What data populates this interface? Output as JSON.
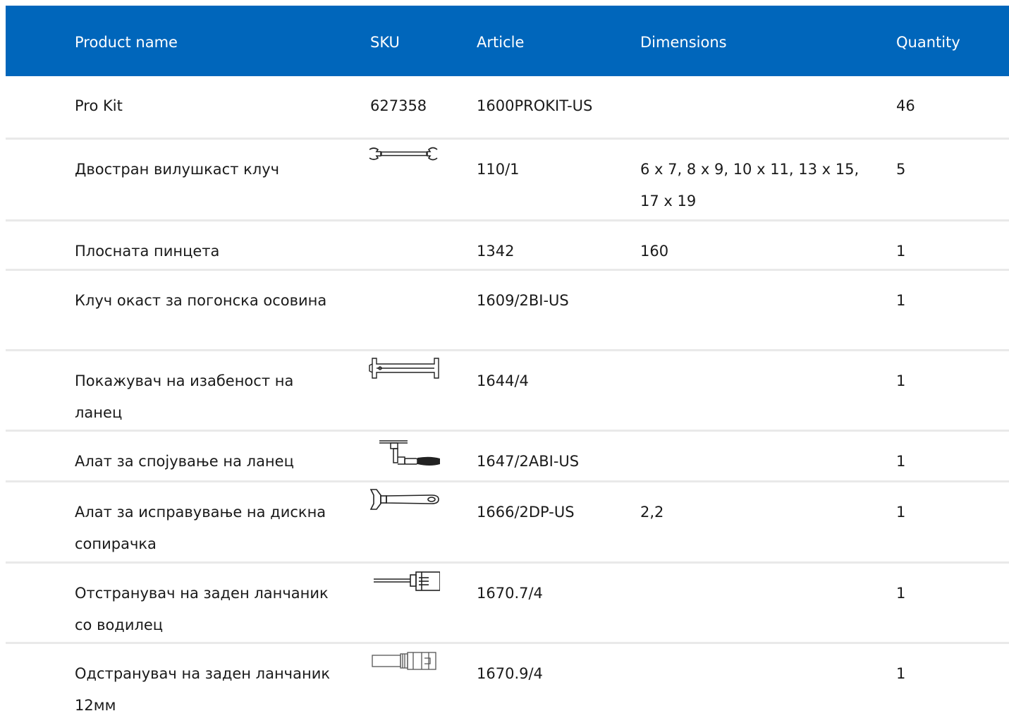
{
  "table": {
    "columns": {
      "name": "Product name",
      "sku": "SKU",
      "article": "Article",
      "dimensions": "Dimensions",
      "quantity": "Quantity"
    },
    "rows": [
      {
        "name": "Pro Kit",
        "sku": "627358",
        "article": "1600PROKIT-US",
        "dimensions": "",
        "quantity": "46",
        "icon": ""
      },
      {
        "name": "Двостран вилушкаст клуч",
        "sku": "",
        "article": "110/1",
        "dimensions": "6 x 7, 8 x 9, 10 x 11, 13 x 15, 17 x 19",
        "quantity": "5",
        "icon": "double-open-end-wrench-icon"
      },
      {
        "name": "Плосната пинцета",
        "sku": "",
        "article": "1342",
        "dimensions": "160",
        "quantity": "1",
        "icon": ""
      },
      {
        "name": "Клуч окаст за погонска осовина",
        "sku": "",
        "article": "1609/2BI-US",
        "dimensions": "",
        "quantity": "1",
        "icon": ""
      },
      {
        "name": "Покажувач на изабеност на ланец",
        "sku": "",
        "article": "1644/4",
        "dimensions": "",
        "quantity": "1",
        "icon": "chain-wear-indicator-icon"
      },
      {
        "name": "Алат за спојување на ланец",
        "sku": "",
        "article": "1647/2ABI-US",
        "dimensions": "",
        "quantity": "1",
        "icon": "chain-tool-icon"
      },
      {
        "name": "Алат за исправување на дискна сопирачка",
        "sku": "",
        "article": "1666/2DP-US",
        "dimensions": "2,2",
        "quantity": "1",
        "icon": "disc-brake-truing-tool-icon"
      },
      {
        "name": "Отстранувач на заден ланчаник со водилец",
        "sku": "",
        "article": "1670.7/4",
        "dimensions": "",
        "quantity": "1",
        "icon": "cassette-remover-with-guide-icon"
      },
      {
        "name": "Одстранувач на заден ланчаник 12мм",
        "sku": "",
        "article": "1670.9/4",
        "dimensions": "",
        "quantity": "1",
        "icon": "cassette-remover-12mm-icon"
      }
    ]
  },
  "colors": {
    "header_bg": "#0066bb",
    "header_text": "#ffffff",
    "row_divider": "#e9e9e9"
  }
}
